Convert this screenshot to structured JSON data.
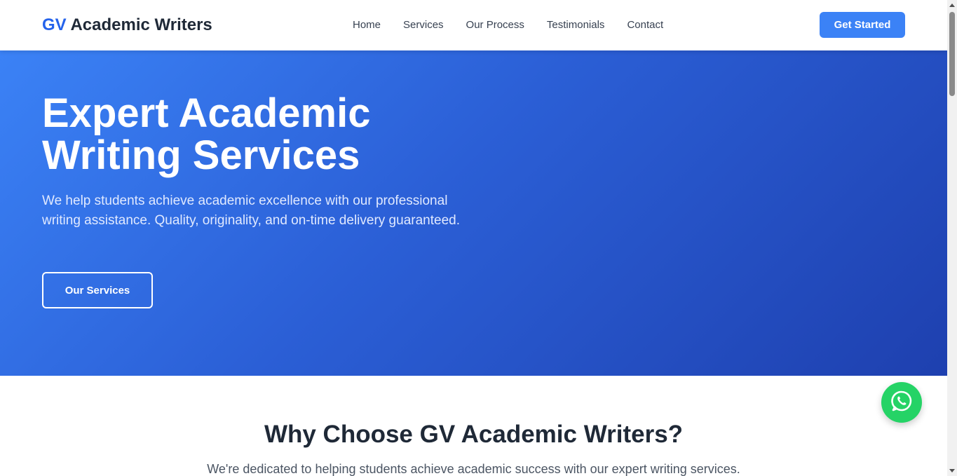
{
  "header": {
    "logo_accent": "GV",
    "logo_text": "Academic Writers",
    "nav": [
      "Home",
      "Services",
      "Our Process",
      "Testimonials",
      "Contact"
    ],
    "cta_label": "Get Started"
  },
  "hero": {
    "title_line1": "Expert Academic",
    "title_line2": "Writing Services",
    "subtitle": "We help students achieve academic excellence with our professional writing assistance. Quality, originality, and on-time delivery guaranteed.",
    "button_label": "Our Services"
  },
  "why": {
    "title": "Why Choose GV Academic Writers?",
    "subtitle": "We're dedicated to helping students achieve academic success with our expert writing services."
  },
  "icons": {
    "whatsapp": "whatsapp-icon"
  },
  "colors": {
    "accent": "#3b82f6",
    "brand_blue": "#2563eb",
    "hero_end": "#1e40af",
    "whatsapp": "#25d366"
  }
}
